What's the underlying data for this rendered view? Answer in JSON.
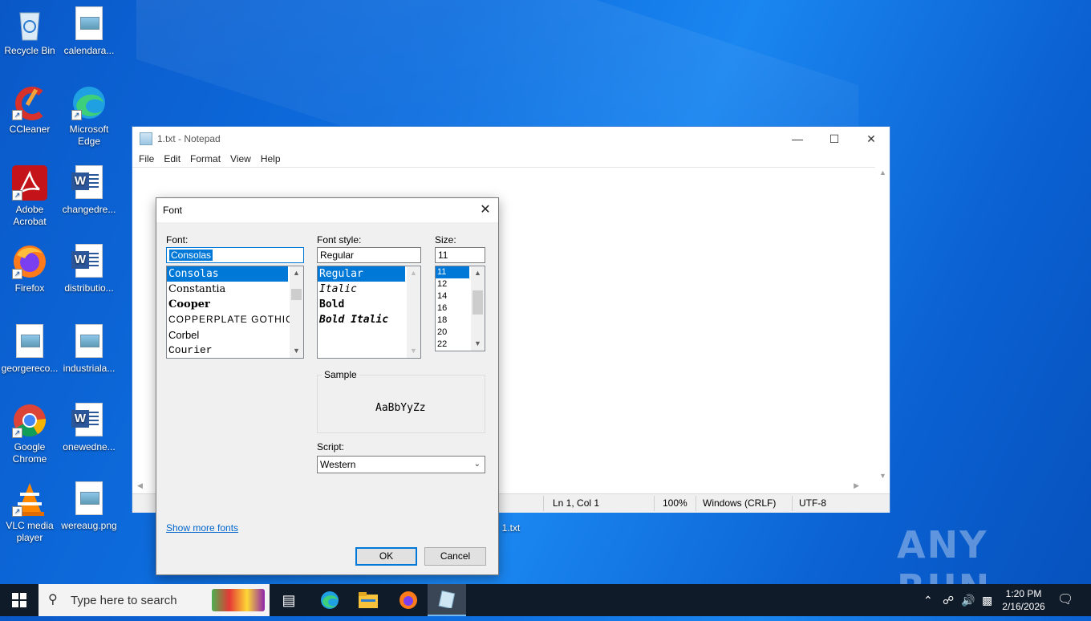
{
  "desktop": {
    "icons": [
      {
        "label": "Recycle Bin",
        "icon": "recycle-bin-icon"
      },
      {
        "label": "calendara...",
        "icon": "image-file-icon"
      },
      {
        "label": "CCleaner",
        "icon": "ccleaner-icon"
      },
      {
        "label": "Microsoft Edge",
        "icon": "edge-icon"
      },
      {
        "label": "Adobe Acrobat",
        "icon": "acrobat-icon"
      },
      {
        "label": "changedre...",
        "icon": "word-doc-icon"
      },
      {
        "label": "Firefox",
        "icon": "firefox-icon"
      },
      {
        "label": "distributio...",
        "icon": "word-doc-icon"
      },
      {
        "label": "georgereco...",
        "icon": "image-file-icon"
      },
      {
        "label": "industriala...",
        "icon": "image-file-icon"
      },
      {
        "label": "Google Chrome",
        "icon": "chrome-icon"
      },
      {
        "label": "onewedne...",
        "icon": "word-doc-icon"
      },
      {
        "label": "VLC media player",
        "icon": "vlc-icon"
      },
      {
        "label": "wereaug.png",
        "icon": "image-file-icon"
      },
      {
        "label": "1.txt",
        "icon": "text-file-icon"
      }
    ]
  },
  "notepad": {
    "title": "1.txt - Notepad",
    "menu": [
      "File",
      "Edit",
      "Format",
      "View",
      "Help"
    ],
    "status": {
      "position": "Ln 1, Col 1",
      "zoom": "100%",
      "line_ending": "Windows (CRLF)",
      "encoding": "UTF-8"
    }
  },
  "font_dialog": {
    "title": "Font",
    "font_label": "Font:",
    "font_value": "Consolas",
    "fonts": [
      "Consolas",
      "Constantia",
      "Cooper",
      "COPPERPLATE GOTHIC",
      "Corbel",
      "Courier"
    ],
    "style_label": "Font style:",
    "style_value": "Regular",
    "styles": [
      "Regular",
      "Italic",
      "Bold",
      "Bold Italic"
    ],
    "size_label": "Size:",
    "size_value": "11",
    "sizes": [
      "11",
      "12",
      "14",
      "16",
      "18",
      "20",
      "22"
    ],
    "sample_label": "Sample",
    "sample_text": "AaBbYyZz",
    "script_label": "Script:",
    "script_value": "Western",
    "more_fonts_link": "Show more fonts",
    "ok_label": "OK",
    "cancel_label": "Cancel"
  },
  "taskbar": {
    "search_placeholder": "Type here to search",
    "time": "1:20 PM",
    "date": "2/16/2026"
  },
  "watermark": "ANY RUN"
}
